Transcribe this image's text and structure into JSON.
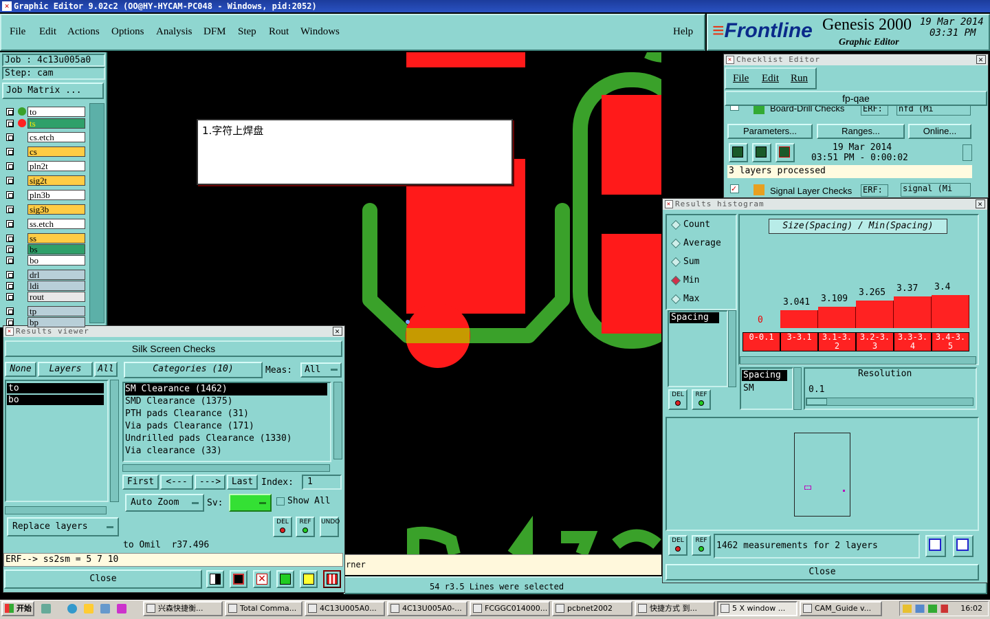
{
  "window": {
    "title": "Graphic Editor 9.02c2 (OO@HY-HYCAM-PC048 - Windows, pid:2052)"
  },
  "menu": {
    "items": [
      "File",
      "Edit",
      "Actions",
      "Options",
      "Analysis",
      "DFM",
      "Step",
      "Rout",
      "Windows"
    ],
    "help": "Help"
  },
  "brand": {
    "logo": "Frontline",
    "product": "Genesis 2000",
    "subtitle": "Graphic Editor",
    "date": "19 Mar 2014",
    "time": "03:31 PM"
  },
  "job": {
    "job_label": "Job : 4c13u005a0",
    "step_label": "Step: cam",
    "matrix_button": "Job Matrix ..."
  },
  "layers": [
    {
      "name": "to",
      "color": "#ffffff",
      "dot": "#3aa12a"
    },
    {
      "name": "ts",
      "color": "#2fa06a",
      "dot": "#ff2222"
    },
    {
      "name": "cs.etch",
      "color": "#ffffff"
    },
    {
      "name": "cs",
      "color": "#ffcc44"
    },
    {
      "name": "pln2t",
      "color": "#ffffff"
    },
    {
      "name": "sig2t",
      "color": "#ffcc44"
    },
    {
      "name": "pln3b",
      "color": "#ffffff"
    },
    {
      "name": "sig3b",
      "color": "#ffcc44"
    },
    {
      "name": "ss.etch",
      "color": "#ffffff"
    },
    {
      "name": "ss",
      "color": "#ffcc44"
    },
    {
      "name": "bs",
      "color": "#2fa06a"
    },
    {
      "name": "bo",
      "color": "#ffffff"
    },
    {
      "name": "drl",
      "color": "#b8cfd8"
    },
    {
      "name": "ldi",
      "color": "#b8cfd8"
    },
    {
      "name": "rout",
      "color": "#e8e8e8"
    },
    {
      "name": "tp",
      "color": "#b8cfd8"
    },
    {
      "name": "bp",
      "color": "#b8cfd8"
    }
  ],
  "annotation": {
    "text": "1.字符上焊盘"
  },
  "results_viewer": {
    "title": "Results viewer",
    "header": "Silk Screen Checks",
    "none": "None",
    "layers": "Layers",
    "all": "All",
    "layer_list": [
      "to",
      "bo"
    ],
    "categories_label": "Categories (10)",
    "meas_label": "Meas:",
    "meas_value": "All",
    "categories": [
      "SM Clearance (1462)",
      "SMD Clearance (1375)",
      "PTH pads Clearance (31)",
      "Via pads Clearance (171)",
      "Undrilled pads Clearance (1330)",
      "Via clearance (33)"
    ],
    "first": "First",
    "prev": "<---",
    "next": "--->",
    "last": "Last",
    "index_label": "Index:",
    "index_value": "1",
    "auto_zoom": "Auto Zoom",
    "sv_label": "Sv:",
    "show_all": "Show All",
    "replace_layers": "Replace layers",
    "del": "DEL",
    "ref": "REF",
    "undo": "UNDO",
    "status": "to Omil  r37.496",
    "erf": "ERF--> ss2sm = 5 7 10",
    "close": "Close"
  },
  "checklist": {
    "title": "Checklist Editor",
    "menu": [
      "File",
      "Edit",
      "Run"
    ],
    "name": "fp-qae",
    "row1": "Board-Drill Checks",
    "erf_label": "ERF:",
    "erf1": "nfd (Mi",
    "parameters": "Parameters...",
    "ranges": "Ranges...",
    "online": "Online...",
    "date": "19 Mar 2014",
    "time": "03:51 PM - 0:00:02",
    "processed": "3 layers processed",
    "row2": "Signal Layer Checks",
    "erf2": "signal (Mi"
  },
  "histogram": {
    "title": "Results histogram",
    "modes": [
      "Count",
      "Average",
      "Sum",
      "Min",
      "Max"
    ],
    "selected_mode": "Min",
    "chart_title": "Size(Spacing) / Min(Spacing)",
    "measure_list": [
      "Spacing"
    ],
    "spacing_label": "Spacing",
    "sm_label": "SM",
    "resolution_label": "Resolution",
    "resolution_value": "0.1",
    "del": "DEL",
    "ref": "REF",
    "summary": "1462 measurements for 2 layers",
    "close": "Close"
  },
  "chart_data": {
    "type": "bar",
    "title": "Size(Spacing) / Min(Spacing)",
    "categories": [
      "0-0.1",
      "3-3.1",
      "3.1-3.2",
      "3.2-3.3",
      "3.3-3.4",
      "3.4-3.5"
    ],
    "values": [
      0,
      3.041,
      3.109,
      3.265,
      3.37,
      3.4
    ],
    "value_labels": [
      "0",
      "3.041",
      "3.109",
      "3.265",
      "3.37",
      "3.4"
    ],
    "ylim": [
      0,
      3.6
    ]
  },
  "canvas": {
    "selection_status": "54 r3.5 Lines were selected",
    "partial_text": "rner"
  },
  "taskbar": {
    "start": "开始",
    "items": [
      "兴森快捷衡...",
      "Total Comma...",
      "4C13U005A0...",
      "4C13U005A0-...",
      "FCGGC014000...",
      "pcbnet2002",
      "快捷方式 到...",
      "5 X window ...",
      "CAM_Guide v..."
    ],
    "clock": "16:02"
  }
}
